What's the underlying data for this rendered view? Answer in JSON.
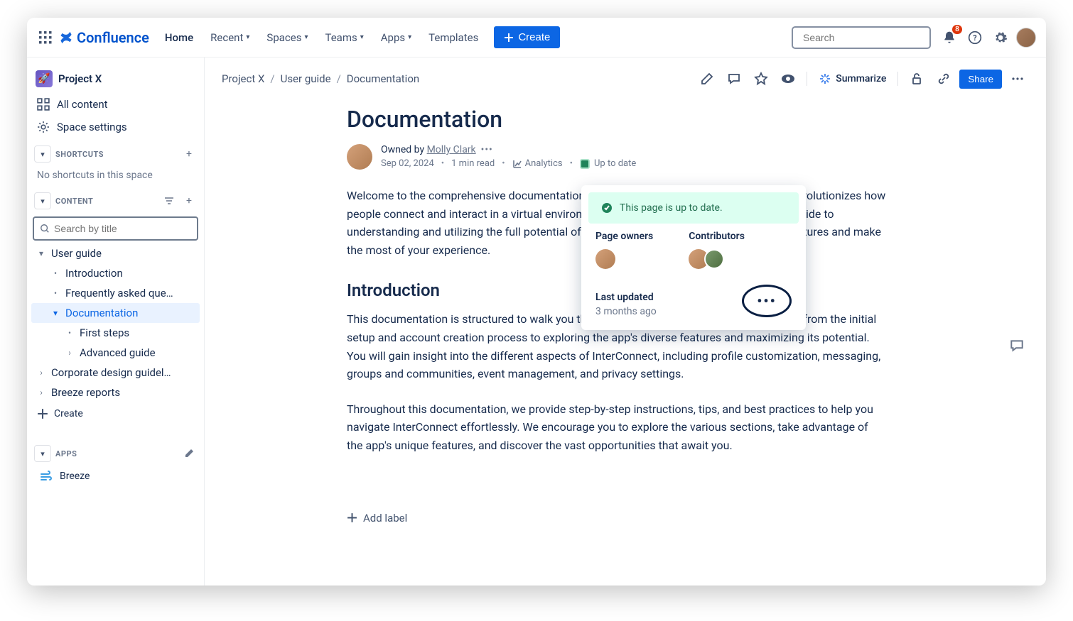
{
  "nav": {
    "product": "Confluence",
    "home": "Home",
    "recent": "Recent",
    "spaces": "Spaces",
    "teams": "Teams",
    "apps": "Apps",
    "templates": "Templates",
    "create": "Create",
    "search_placeholder": "Search",
    "notif_count": "8"
  },
  "sidebar": {
    "space_name": "Project X",
    "all_content": "All content",
    "space_settings": "Space settings",
    "shortcuts_label": "SHORTCUTS",
    "no_shortcuts": "No shortcuts in this space",
    "content_label": "CONTENT",
    "filter_placeholder": "Search by title",
    "tree": {
      "user_guide": "User guide",
      "introduction": "Introduction",
      "faq": "Frequently asked que…",
      "documentation": "Documentation",
      "first_steps": "First steps",
      "advanced": "Advanced guide",
      "corp": "Corporate design guidel…",
      "breeze_reports": "Breeze reports"
    },
    "create_page": "Create",
    "apps_label": "APPS",
    "breeze": "Breeze"
  },
  "breadcrumb": {
    "a": "Project X",
    "b": "User guide",
    "c": "Documentation"
  },
  "header": {
    "summarize": "Summarize",
    "share": "Share"
  },
  "page": {
    "title": "Documentation",
    "owned_by_prefix": "Owned by ",
    "owner": "Molly Clark",
    "date": "Sep 02, 2024",
    "read": "1 min read",
    "analytics": "Analytics",
    "status": "Up to date",
    "intro_para": "Welcome to the comprehensive documentation for a cutting-edge social media app that revolutionizes how people connect and interact in a virtual environment. This documentation serves as your guide to understanding and utilizing the full potential of the app, empowering you to navigate its features and make the most of your experience.",
    "h2": "Introduction",
    "p2": "This documentation is structured to walk you through the various aspects of InterConnect, from the initial setup and account creation process to exploring the app's diverse features and maximizing its potential. You will gain insight into the different aspects of InterConnect, including profile customization, messaging, groups and communities, event management, and privacy settings.",
    "p3": "Throughout this documentation, we provide step-by-step instructions, tips, and best practices to help you navigate InterConnect effortlessly. We encourage you to explore the various sections, take advantage of the app's unique features, and discover the vast opportunities that await you.",
    "add_label": "Add label"
  },
  "popover": {
    "banner": "This page is up to date.",
    "page_owners": "Page owners",
    "contributors": "Contributors",
    "last_updated_label": "Last updated",
    "last_updated_value": "3 months ago"
  }
}
